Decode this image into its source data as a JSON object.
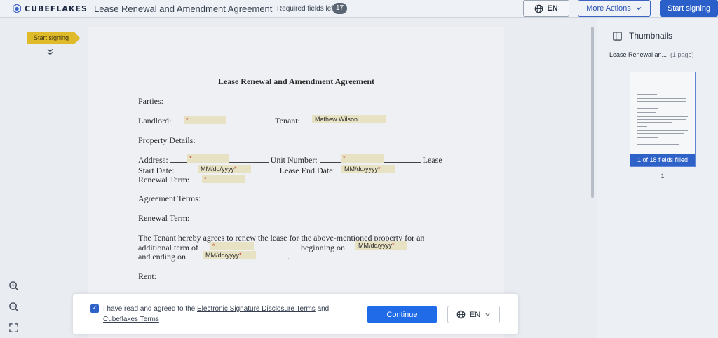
{
  "header": {
    "brand": "CUBEFLAKES",
    "doc_title": "Lease Renewal and Amendment Agreement",
    "required_label": "Required fields left",
    "required_count": "17",
    "language": "EN",
    "more_actions": "More Actions",
    "start_signing": "Start signing"
  },
  "left_gutter": {
    "flag_label": "Start signing"
  },
  "document": {
    "title": "Lease Renewal and Amendment Agreement",
    "parties": "Parties:",
    "landlord_label": "Landlord:",
    "tenant_label": "Tenant:",
    "tenant_value": "Mathew Wilson",
    "property_details": "Property Details:",
    "address_label": "Address:",
    "unit_label": "Unit Number:",
    "lease_word": "Lease",
    "start_date_label": "Start Date:",
    "end_date_label": "Lease End Date:",
    "renewal_term_label": "Renewal Term:",
    "agreement_terms": "Agreement Terms:",
    "renewal_term_heading": "Renewal Term:",
    "para_line1": "The Tenant hereby agrees to renew the lease for the above-mentioned property for an",
    "para_line2_a": "additional term of",
    "para_line2_b": "beginning on",
    "para_line3_a": "and ending on",
    "para_line3_b": ".",
    "rent_heading": "Rent:",
    "date_placeholder": "MM/dd/yyyy",
    "required_mark": "*"
  },
  "thumbnails": {
    "heading": "Thumbnails",
    "doc_name": "Lease Renewal an...",
    "page_count": "(1 page)",
    "status": "1 of 18 fields filled",
    "page_number": "1"
  },
  "consent": {
    "text_before": "I have read and agreed to the",
    "link1": "Electronic Signature Disclosure Terms",
    "text_and": "and",
    "link2": "Cubeflakes Terms",
    "continue": "Continue",
    "language": "EN",
    "checked": true
  },
  "colors": {
    "primary": "#2a5fc9",
    "flag": "#dfba2b",
    "field_bg": "#e8e2c4",
    "required": "#c0392b"
  }
}
